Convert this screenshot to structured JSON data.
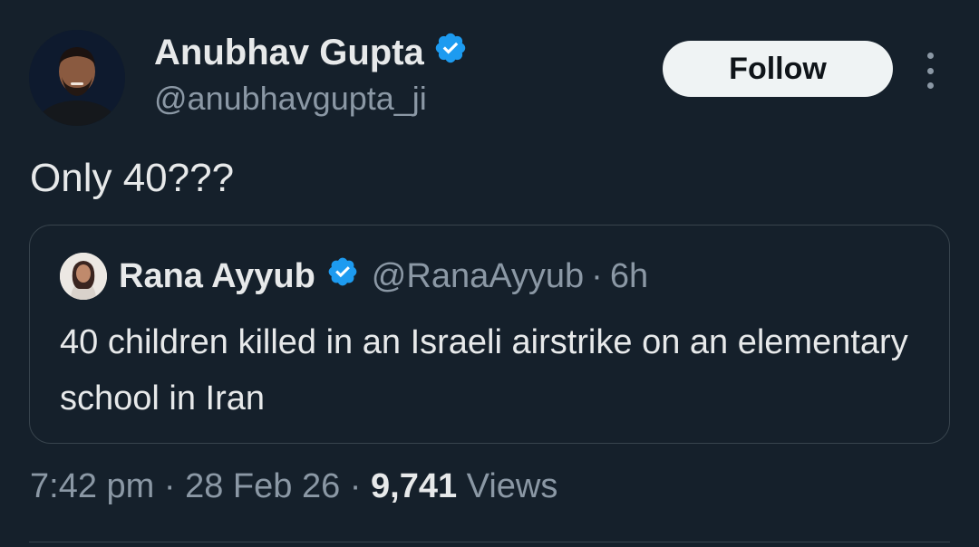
{
  "tweet": {
    "author": {
      "name": "Anubhav Gupta",
      "handle": "@anubhavgupta_ji",
      "verified": true,
      "avatar": "avatar-photo"
    },
    "follow_label": "Follow",
    "more_icon": "more-options-icon",
    "text": "Only 40???",
    "quoted": {
      "author_name": "Rana Ayyub",
      "author_handle": "@RanaAyyub",
      "separator": "·",
      "age": "6h",
      "verified": true,
      "text": "40 children killed in an Israeli airstrike on an elementary school in Iran"
    },
    "meta": {
      "time": "7:42 pm",
      "separator": "·",
      "date": "28 Feb 26",
      "views_count": "9,741",
      "views_label": "Views"
    }
  },
  "colors": {
    "background": "#15202b",
    "primary_text": "#e7e9ea",
    "secondary_text": "#8b98a5",
    "verified_blue": "#1d9bf0",
    "follow_button_bg": "#eff3f4",
    "border": "#38444d"
  }
}
